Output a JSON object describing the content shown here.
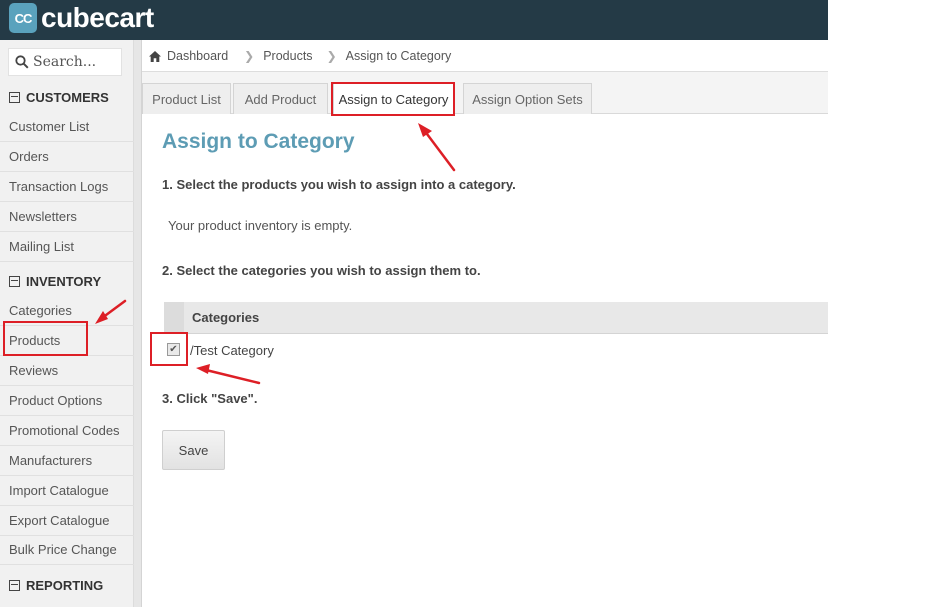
{
  "brand": {
    "mark": "CC",
    "name": "cubecart"
  },
  "search": {
    "placeholder": "Search..."
  },
  "sidebar": {
    "sections": [
      {
        "label": "CUSTOMERS"
      },
      {
        "label": "INVENTORY"
      },
      {
        "label": "REPORTING"
      }
    ],
    "customers": [
      "Customer List",
      "Orders",
      "Transaction Logs",
      "Newsletters",
      "Mailing List"
    ],
    "inventory": [
      "Categories",
      "Products",
      "Reviews",
      "Product Options",
      "Promotional Codes",
      "Manufacturers",
      "Import Catalogue",
      "Export Catalogue",
      "Bulk Price Change"
    ]
  },
  "breadcrumb": [
    "Dashboard",
    "Products",
    "Assign to Category"
  ],
  "tabs": [
    "Product List",
    "Add Product",
    "Assign to Category",
    "Assign Option Sets"
  ],
  "main": {
    "title": "Assign to Category",
    "step1": "1. Select the products you wish to assign into a category.",
    "empty_message": "Your product inventory is empty.",
    "step2": "2. Select the categories you wish to assign them to.",
    "table_header": "Categories",
    "category_row": "/Test Category",
    "category_checked": true,
    "step3": "3. Click \"Save\".",
    "save_label": "Save"
  },
  "colors": {
    "header": "#243a46",
    "accent": "#5d9cb4",
    "annotation": "#dd1f26"
  }
}
